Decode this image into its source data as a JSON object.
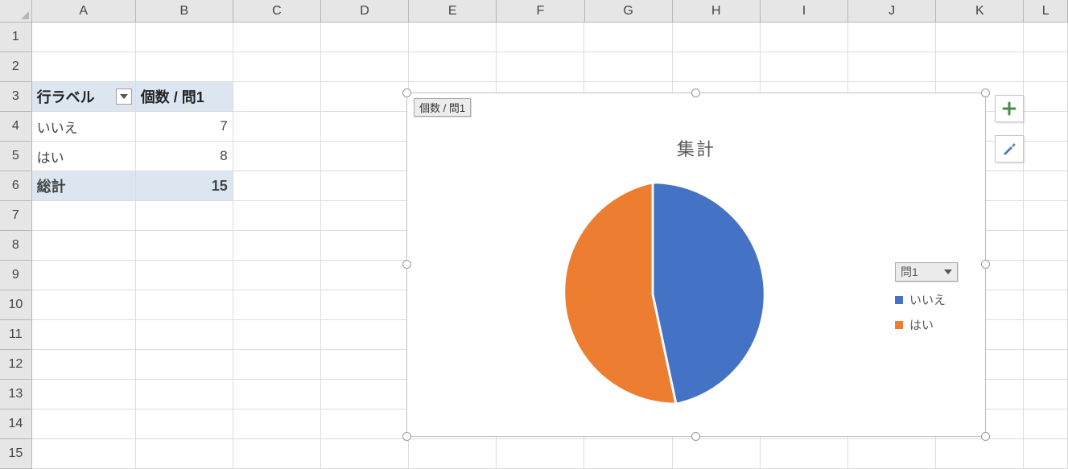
{
  "columns": [
    "A",
    "B",
    "C",
    "D",
    "E",
    "F",
    "G",
    "H",
    "I",
    "J",
    "K",
    "L"
  ],
  "rows": [
    "1",
    "2",
    "3",
    "4",
    "5",
    "6",
    "7",
    "8",
    "9",
    "10",
    "11",
    "12",
    "13",
    "14",
    "15"
  ],
  "pivot": {
    "row_label_header": "行ラベル",
    "value_header": "個数 / 問1",
    "rows": [
      {
        "label": "いいえ",
        "value": 7
      },
      {
        "label": "はい",
        "value": 8
      }
    ],
    "total_label": "総計",
    "total_value": 15
  },
  "chart": {
    "field_button": "個数 / 問1",
    "title": "集計",
    "legend_filter": "問1",
    "series_labels": [
      "いいえ",
      "はい"
    ],
    "colors": {
      "いいえ": "#4472c4",
      "はい": "#ed7d31"
    }
  },
  "chart_data": {
    "type": "pie",
    "title": "集計",
    "categories": [
      "いいえ",
      "はい"
    ],
    "values": [
      7,
      8
    ],
    "colors": [
      "#4472c4",
      "#ed7d31"
    ],
    "value_field": "個数 / 問1",
    "legend_position": "right"
  }
}
